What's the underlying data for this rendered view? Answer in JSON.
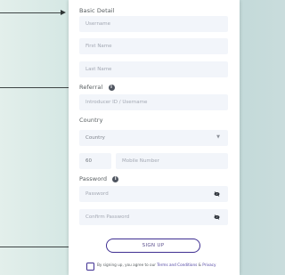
{
  "form": {
    "basic_detail_label": "Basic Detail",
    "username_placeholder": "Username",
    "first_name_placeholder": "First Name",
    "last_name_placeholder": "Last Name",
    "referral_label": "Referral",
    "referral_placeholder": "Introducer ID / Username",
    "country_label": "Country",
    "country_value": "Country",
    "phone_code": "60",
    "mobile_placeholder": "Mobile Number",
    "password_label": "Password",
    "password_placeholder": "Password",
    "confirm_password_placeholder": "Confirm Password",
    "signup_label": "SIGN UP",
    "agree_prefix": "By signing up, you agree to our ",
    "agree_terms": "Terms and Conditions",
    "agree_amp": " & ",
    "agree_privacy": "Privacy"
  },
  "icons": {
    "info": "info-icon",
    "eye": "eye-slash-icon",
    "dropdown": "chevron-down-icon",
    "arrow": "arrow-right-icon"
  },
  "colors": {
    "accent": "#3f2f92",
    "field_bg": "#f2f5fa"
  }
}
